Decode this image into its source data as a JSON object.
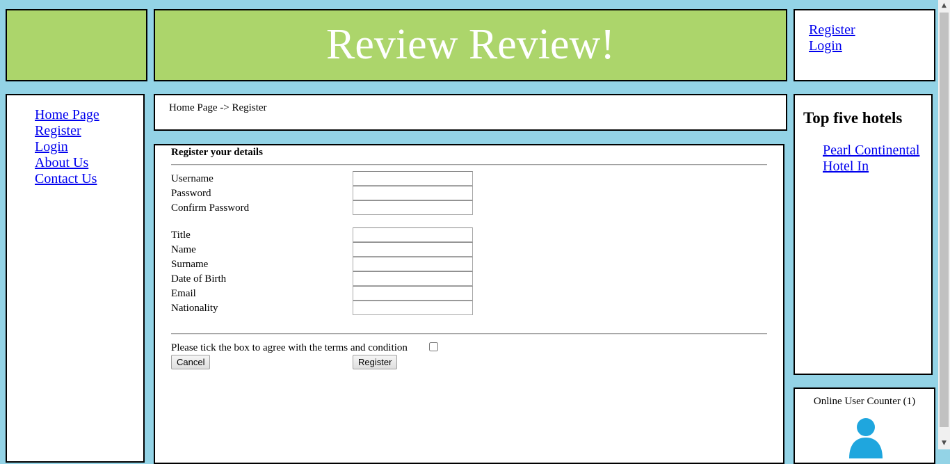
{
  "header": {
    "title": "Review Review!"
  },
  "auth": {
    "register": "Register",
    "login": "Login"
  },
  "nav": {
    "items": [
      {
        "label": "Home Page"
      },
      {
        "label": "Register"
      },
      {
        "label": "Login"
      },
      {
        "label": "About Us"
      },
      {
        "label": "Contact Us"
      }
    ]
  },
  "breadcrumb": {
    "text": "Home Page -> Register"
  },
  "form": {
    "heading": "Register your details",
    "fields": [
      {
        "label": "Username",
        "value": ""
      },
      {
        "label": "Password",
        "value": ""
      },
      {
        "label": "Confirm Password",
        "value": ""
      },
      {
        "label": "Title",
        "value": ""
      },
      {
        "label": "Name",
        "value": ""
      },
      {
        "label": "Surname",
        "value": ""
      },
      {
        "label": "Date of Birth",
        "value": ""
      },
      {
        "label": "Email",
        "value": ""
      },
      {
        "label": "Nationality",
        "value": ""
      }
    ],
    "terms_label": "Please tick the box to agree with the terms and condition",
    "terms_checked": false,
    "cancel_label": "Cancel",
    "register_label": "Register"
  },
  "top_hotels": {
    "heading": "Top five hotels",
    "items": [
      {
        "label": "Pearl Continental Hotel In"
      }
    ]
  },
  "counter": {
    "text": "Online User Counter (1)"
  },
  "colors": {
    "background": "#93d3e6",
    "header": "#acd56b",
    "link": "#0000ee",
    "user_icon": "#1fa6de"
  },
  "icons": {
    "user": "user-icon",
    "scroll_up": "scroll-up-arrow-icon",
    "scroll_down": "scroll-down-arrow-icon"
  }
}
